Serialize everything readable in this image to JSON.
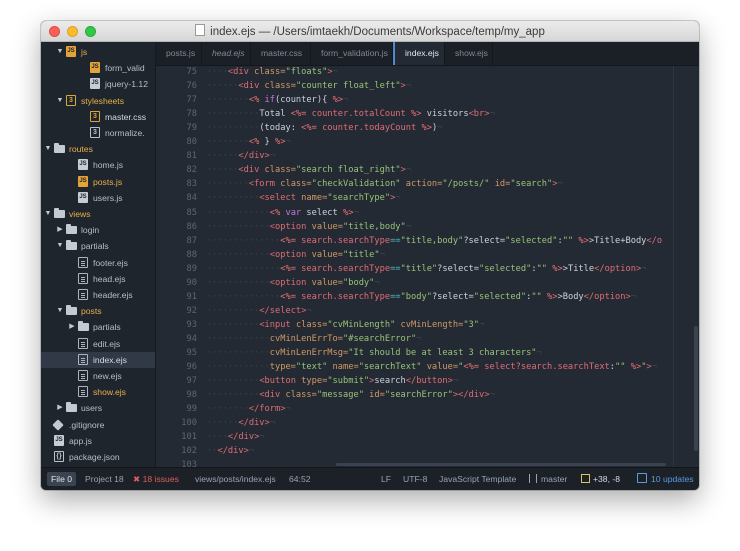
{
  "window": {
    "title": "index.ejs — /Users/imtaekh/Documents/Workspace/temp/my_app"
  },
  "sidebar": {
    "rows": [
      {
        "label": "js",
        "kind": "folder-open",
        "color": "yellow",
        "depth": 1
      },
      {
        "label": "form_valid",
        "kind": "jsy",
        "depth": 3
      },
      {
        "label": "jquery-1.12",
        "kind": "js",
        "depth": 3
      },
      {
        "label": "stylesheets",
        "kind": "folder-open",
        "color": "yellow",
        "depth": 1,
        "icon": "css3"
      },
      {
        "label": "master.css",
        "kind": "css",
        "depth": 3,
        "color": "white"
      },
      {
        "label": "normalize.",
        "kind": "cssg",
        "depth": 3
      },
      {
        "label": "routes",
        "kind": "folder-open",
        "color": "yellow",
        "depth": 0
      },
      {
        "label": "home.js",
        "kind": "js",
        "depth": 2
      },
      {
        "label": "posts.js",
        "kind": "jsy",
        "depth": 2,
        "color": "yellow"
      },
      {
        "label": "users.js",
        "kind": "js",
        "depth": 2
      },
      {
        "label": "views",
        "kind": "folder-open",
        "color": "yellow",
        "depth": 0
      },
      {
        "label": "login",
        "kind": "folder-closed",
        "depth": 1
      },
      {
        "label": "partials",
        "kind": "folder-open",
        "depth": 1
      },
      {
        "label": "footer.ejs",
        "kind": "ejs",
        "depth": 2
      },
      {
        "label": "head.ejs",
        "kind": "ejs",
        "depth": 2
      },
      {
        "label": "header.ejs",
        "kind": "ejs",
        "depth": 2
      },
      {
        "label": "posts",
        "kind": "folder-open",
        "color": "yellow",
        "depth": 1
      },
      {
        "label": "partials",
        "kind": "folder-closed",
        "depth": 2
      },
      {
        "label": "edit.ejs",
        "kind": "ejs",
        "depth": 2
      },
      {
        "label": "index.ejs",
        "kind": "ejs",
        "depth": 2,
        "selected": true,
        "color": "white"
      },
      {
        "label": "new.ejs",
        "kind": "ejs",
        "depth": 2
      },
      {
        "label": "show.ejs",
        "kind": "ejs",
        "depth": 2,
        "color": "yellow"
      },
      {
        "label": "users",
        "kind": "folder-closed",
        "depth": 1
      },
      {
        "label": ".gitignore",
        "kind": "git",
        "depth": 0
      },
      {
        "label": "app.js",
        "kind": "js",
        "depth": 0
      },
      {
        "label": "package.json",
        "kind": "json",
        "depth": 0
      }
    ]
  },
  "tabs": [
    {
      "label": "posts.js"
    },
    {
      "label": "head.ejs",
      "italic": true
    },
    {
      "label": "master.css"
    },
    {
      "label": "form_validation.js"
    },
    {
      "label": "index.ejs",
      "active": true
    },
    {
      "label": "show.ejs"
    }
  ],
  "editor": {
    "lines": [
      {
        "n": "75",
        "tokens": [
          [
            "ws",
            "    "
          ],
          [
            "tag",
            "<div "
          ],
          [
            "attr",
            "class="
          ],
          [
            "str",
            "\"floats\""
          ],
          [
            "tag",
            ">"
          ],
          [
            "ws",
            "¬"
          ]
        ]
      },
      {
        "n": "76",
        "tokens": [
          [
            "ws",
            "      "
          ],
          [
            "tag",
            "<div "
          ],
          [
            "attr",
            "class="
          ],
          [
            "str",
            "\"counter float_left\""
          ],
          [
            "tag",
            ">"
          ],
          [
            "ws",
            "¬"
          ]
        ]
      },
      {
        "n": "77",
        "tokens": [
          [
            "ws",
            "        "
          ],
          [
            "ejs",
            "<% "
          ],
          [
            "kw",
            "if"
          ],
          [
            "txt",
            "(counter){ "
          ],
          [
            "ejs",
            "%>"
          ],
          [
            "ws",
            "¬"
          ]
        ]
      },
      {
        "n": "78",
        "tokens": [
          [
            "ws",
            "          "
          ],
          [
            "txt",
            "Total "
          ],
          [
            "ejs",
            "<%= "
          ],
          [
            "prop",
            "counter.totalCount "
          ],
          [
            "ejs",
            "%>"
          ],
          [
            "txt",
            " visitors"
          ],
          [
            "tag",
            "<br>"
          ],
          [
            "ws",
            "¬"
          ]
        ]
      },
      {
        "n": "79",
        "tokens": [
          [
            "ws",
            "          "
          ],
          [
            "txt",
            "(today: "
          ],
          [
            "ejs",
            "<%= "
          ],
          [
            "prop",
            "counter.todayCount "
          ],
          [
            "ejs",
            "%>"
          ],
          [
            "txt",
            ")"
          ],
          [
            "ws",
            "¬"
          ]
        ]
      },
      {
        "n": "80",
        "tokens": [
          [
            "ws",
            "        "
          ],
          [
            "ejs",
            "<% "
          ],
          [
            "txt",
            "} "
          ],
          [
            "ejs",
            "%>"
          ],
          [
            "ws",
            "¬"
          ]
        ]
      },
      {
        "n": "81",
        "tokens": [
          [
            "ws",
            "      "
          ],
          [
            "tag",
            "</div>"
          ],
          [
            "ws",
            "¬"
          ]
        ]
      },
      {
        "n": "82",
        "tokens": [
          [
            "ws",
            "      "
          ],
          [
            "tag",
            "<div "
          ],
          [
            "attr",
            "class="
          ],
          [
            "str",
            "\"search float_right\""
          ],
          [
            "tag",
            ">"
          ],
          [
            "ws",
            "¬"
          ]
        ]
      },
      {
        "n": "83",
        "tokens": [
          [
            "ws",
            "        "
          ],
          [
            "tag",
            "<form "
          ],
          [
            "attr",
            "class="
          ],
          [
            "str",
            "\"checkValidation\""
          ],
          [
            "attr",
            " action="
          ],
          [
            "str",
            "\"/posts/\""
          ],
          [
            "attr",
            " id="
          ],
          [
            "str",
            "\"search\""
          ],
          [
            "tag",
            ">"
          ],
          [
            "ws",
            "¬"
          ]
        ]
      },
      {
        "n": "84",
        "tokens": [
          [
            "ws",
            "          "
          ],
          [
            "tag",
            "<select "
          ],
          [
            "attr",
            "name="
          ],
          [
            "str",
            "\"searchType\""
          ],
          [
            "tag",
            ">"
          ],
          [
            "ws",
            "¬"
          ]
        ]
      },
      {
        "n": "85",
        "tokens": [
          [
            "ws",
            "            "
          ],
          [
            "ejs",
            "<% "
          ],
          [
            "kw",
            "var "
          ],
          [
            "txt",
            "select "
          ],
          [
            "ejs",
            "%>"
          ],
          [
            "ws",
            "¬"
          ]
        ]
      },
      {
        "n": "86",
        "tokens": [
          [
            "ws",
            "            "
          ],
          [
            "tag",
            "<option "
          ],
          [
            "attr",
            "value="
          ],
          [
            "str",
            "\"title,body\""
          ],
          [
            "ws",
            "¬"
          ]
        ]
      },
      {
        "n": "87",
        "tokens": [
          [
            "ws",
            "              "
          ],
          [
            "ejs",
            "<%= "
          ],
          [
            "prop",
            "search.searchType"
          ],
          [
            "op",
            "=="
          ],
          [
            "str",
            "\"title,body\""
          ],
          [
            "txt",
            "?select="
          ],
          [
            "str",
            "\"selected\""
          ],
          [
            "txt",
            ":"
          ],
          [
            "str",
            "\"\" "
          ],
          [
            "ejs",
            "%>"
          ],
          [
            "txt",
            ">Title+Body"
          ],
          [
            "tag",
            "</o"
          ]
        ]
      },
      {
        "n": "88",
        "tokens": [
          [
            "ws",
            "            "
          ],
          [
            "tag",
            "<option "
          ],
          [
            "attr",
            "value="
          ],
          [
            "str",
            "\"title\""
          ],
          [
            "ws",
            "¬"
          ]
        ]
      },
      {
        "n": "89",
        "tokens": [
          [
            "ws",
            "              "
          ],
          [
            "ejs",
            "<%= "
          ],
          [
            "prop",
            "search.searchType"
          ],
          [
            "op",
            "=="
          ],
          [
            "str",
            "\"title\""
          ],
          [
            "txt",
            "?select="
          ],
          [
            "str",
            "\"selected\""
          ],
          [
            "txt",
            ":"
          ],
          [
            "str",
            "\"\" "
          ],
          [
            "ejs",
            "%>"
          ],
          [
            "txt",
            ">Title"
          ],
          [
            "tag",
            "</option>"
          ],
          [
            "ws",
            "¬"
          ]
        ]
      },
      {
        "n": "90",
        "tokens": [
          [
            "ws",
            "            "
          ],
          [
            "tag",
            "<option "
          ],
          [
            "attr",
            "value="
          ],
          [
            "str",
            "\"body\""
          ],
          [
            "ws",
            "¬"
          ]
        ]
      },
      {
        "n": "91",
        "tokens": [
          [
            "ws",
            "              "
          ],
          [
            "ejs",
            "<%= "
          ],
          [
            "prop",
            "search.searchType"
          ],
          [
            "op",
            "=="
          ],
          [
            "str",
            "\"body\""
          ],
          [
            "txt",
            "?select="
          ],
          [
            "str",
            "\"selected\""
          ],
          [
            "txt",
            ":"
          ],
          [
            "str",
            "\"\" "
          ],
          [
            "ejs",
            "%>"
          ],
          [
            "txt",
            ">Body"
          ],
          [
            "tag",
            "</option>"
          ],
          [
            "ws",
            "¬"
          ]
        ]
      },
      {
        "n": "92",
        "tokens": [
          [
            "ws",
            "          "
          ],
          [
            "tag",
            "</select>"
          ],
          [
            "ws",
            "¬"
          ]
        ]
      },
      {
        "n": "93",
        "tokens": [
          [
            "ws",
            "          "
          ],
          [
            "tag",
            "<input "
          ],
          [
            "attr",
            "class="
          ],
          [
            "str",
            "\"cvMinLength\""
          ],
          [
            "attr",
            " cvMinLength="
          ],
          [
            "str",
            "\"3\""
          ],
          [
            "ws",
            "¬"
          ]
        ]
      },
      {
        "n": "94",
        "tokens": [
          [
            "ws",
            "            "
          ],
          [
            "attr",
            "cvMinLenErrTo="
          ],
          [
            "str",
            "\"#searchError\""
          ],
          [
            "ws",
            "¬"
          ]
        ]
      },
      {
        "n": "95",
        "tokens": [
          [
            "ws",
            "            "
          ],
          [
            "attr",
            "cvMinLenErrMsg="
          ],
          [
            "str",
            "\"It should be at least 3 characters\""
          ],
          [
            "ws",
            "¬"
          ]
        ]
      },
      {
        "n": "96",
        "tokens": [
          [
            "ws",
            "            "
          ],
          [
            "attr",
            "type="
          ],
          [
            "str",
            "\"text\""
          ],
          [
            "attr",
            " name="
          ],
          [
            "str",
            "\"searchText\""
          ],
          [
            "attr",
            " value="
          ],
          [
            "str",
            "\""
          ],
          [
            "ejs",
            "<%= "
          ],
          [
            "prop",
            "select?search.searchText"
          ],
          [
            "txt",
            ":"
          ],
          [
            "str",
            "\"\" "
          ],
          [
            "ejs",
            "%>"
          ],
          [
            "str",
            "\""
          ],
          [
            "tag",
            ">"
          ],
          [
            "ws",
            "¬"
          ]
        ]
      },
      {
        "n": "97",
        "tokens": [
          [
            "ws",
            "          "
          ],
          [
            "tag",
            "<button "
          ],
          [
            "attr",
            "type="
          ],
          [
            "str",
            "\"submit\""
          ],
          [
            "tag",
            ">"
          ],
          [
            "txt",
            "search"
          ],
          [
            "tag",
            "</button>"
          ],
          [
            "ws",
            "¬"
          ]
        ]
      },
      {
        "n": "98",
        "tokens": [
          [
            "ws",
            "          "
          ],
          [
            "tag",
            "<div "
          ],
          [
            "attr",
            "class="
          ],
          [
            "str",
            "\"message\""
          ],
          [
            "attr",
            " id="
          ],
          [
            "str",
            "\"searchError\""
          ],
          [
            "tag",
            "></div>"
          ],
          [
            "ws",
            "¬"
          ]
        ]
      },
      {
        "n": "99",
        "tokens": [
          [
            "ws",
            "        "
          ],
          [
            "tag",
            "</form>"
          ],
          [
            "ws",
            "¬"
          ]
        ]
      },
      {
        "n": "100",
        "tokens": [
          [
            "ws",
            "      "
          ],
          [
            "tag",
            "</div>"
          ],
          [
            "ws",
            "¬"
          ]
        ]
      },
      {
        "n": "101",
        "tokens": [
          [
            "ws",
            "    "
          ],
          [
            "tag",
            "</div>"
          ],
          [
            "ws",
            "¬"
          ]
        ]
      },
      {
        "n": "102",
        "tokens": [
          [
            "ws",
            "  "
          ],
          [
            "tag",
            "</div>"
          ],
          [
            "ws",
            "¬"
          ]
        ]
      },
      {
        "n": "103",
        "tokens": []
      }
    ]
  },
  "status": {
    "file_tab": "File 0",
    "project_tab": "Project 18",
    "issues": "✖ 18 issues",
    "path": "views/posts/index.ejs",
    "cursor": "64:52",
    "line_ending": "LF",
    "encoding": "UTF-8",
    "grammar": "JavaScript Template",
    "branch": "master",
    "diff": "+38, -8",
    "updates": "10 updates"
  },
  "colors": {
    "accent": "#4f8bd4",
    "editor_bg": "#232a33",
    "sidebar_bg": "#1f252d",
    "error": "#e05c5c"
  }
}
